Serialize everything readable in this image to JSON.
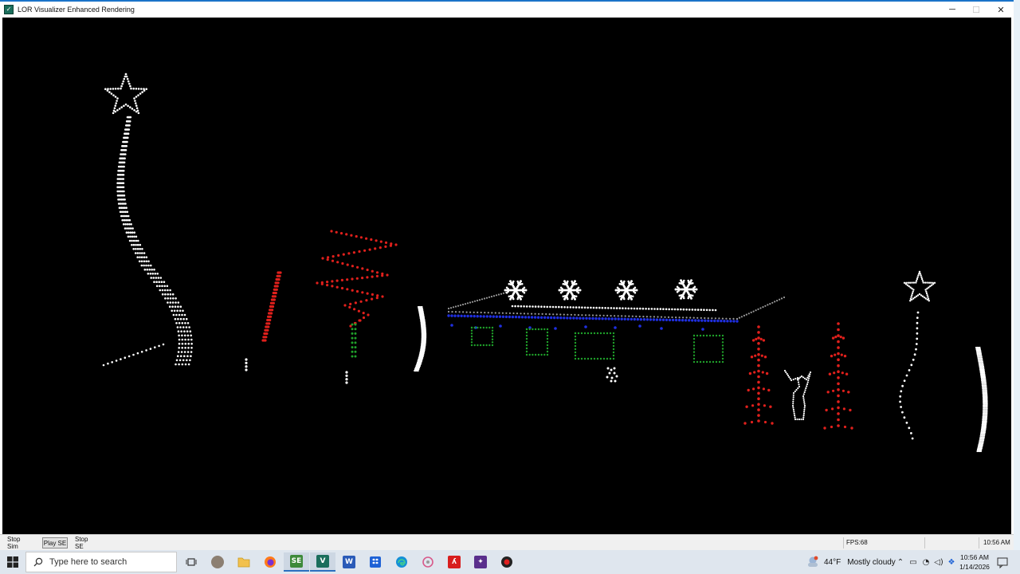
{
  "window": {
    "title": "LOR Visualizer Enhanced Rendering",
    "icon": "visualizer-app-icon",
    "controls": {
      "minimize": "─",
      "maximize": "☐",
      "close": "✕"
    }
  },
  "statusbar": {
    "buttons": [
      {
        "label": "Stop Sim"
      },
      {
        "label": "Play SE"
      },
      {
        "label": "Stop SE"
      }
    ],
    "fps": "FPS:68",
    "time": "10:56 AM"
  },
  "taskbar": {
    "search_placeholder": "Type here to search",
    "apps": [
      {
        "name": "task-view",
        "icon": "task-view-icon"
      },
      {
        "name": "app-gray",
        "icon": "app-icon"
      },
      {
        "name": "file-explorer",
        "icon": "folder-icon"
      },
      {
        "name": "firefox",
        "icon": "firefox-icon"
      },
      {
        "name": "sequence-editor",
        "icon": "sequence-editor-icon",
        "glyph": "SE"
      },
      {
        "name": "lor-visualizer",
        "icon": "visualizer-icon",
        "glyph": "V"
      },
      {
        "name": "word",
        "icon": "word-icon",
        "glyph": "W"
      },
      {
        "name": "dropbox",
        "icon": "dropbox-icon"
      },
      {
        "name": "edge",
        "icon": "edge-icon"
      },
      {
        "name": "tool",
        "icon": "tool-icon"
      },
      {
        "name": "acrobat",
        "icon": "acrobat-icon"
      },
      {
        "name": "lor-app",
        "icon": "lor-icon"
      },
      {
        "name": "hub",
        "icon": "hub-icon"
      }
    ],
    "weather": {
      "temp": "44°F",
      "condition": "Mostly cloudy",
      "alert": "1"
    },
    "clock": {
      "time": "10:56 AM",
      "date": "1/14/2026"
    }
  },
  "colors": {
    "canvas_bg": "#000000",
    "white_lights": "#ffffff",
    "red_lights": "#e0201c",
    "green_lights": "#1fa12a",
    "blue_lights": "#1f2fe0",
    "gray_lights": "#9a9a9a"
  },
  "scene": {
    "display_elements": [
      "spiral-tree-with-star",
      "candy-cane-red",
      "zigzag-tree-red",
      "tree-trunk-green",
      "ground-stake",
      "ground-stake",
      "arch-left",
      "roofline-gray",
      "roofline-white",
      "eave-blue",
      "window-outline",
      "window-outline",
      "window-outline",
      "window-outline",
      "snowflake",
      "snowflake",
      "snowflake",
      "snowflake",
      "snowman-small",
      "red-tree-left",
      "reindeer-white",
      "red-tree-right",
      "star-tree-right",
      "arch-right"
    ]
  }
}
